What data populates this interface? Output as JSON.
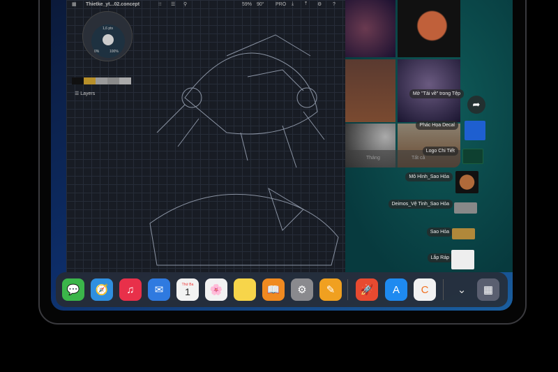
{
  "concept_app": {
    "file_name": "Thietke_yt...02.concept",
    "zoom": "59%",
    "angle": "90°",
    "pro_label": "PRO",
    "brush_size": "1,6 pts",
    "opacity_min": "0%",
    "opacity_max": "100%",
    "layers_label": "Layers",
    "swatch_colors": [
      "#101010",
      "#b8902a",
      "#9a9a9a",
      "#8a8a8a",
      "#aaaaaa"
    ]
  },
  "photos": {
    "tabs": [
      "Tháng",
      "Tất cả"
    ]
  },
  "drag_menu": {
    "items": [
      {
        "label": "Mở \"Tải về\" trong Tệp"
      },
      {
        "label": "Phác Họa Decal"
      },
      {
        "label": "Logo Chi Tiết"
      },
      {
        "label": "Mô Hình_Sao Hỏa"
      },
      {
        "label": "Deimos_Vệ Tinh_Sao Hỏa"
      },
      {
        "label": "Sao Hỏa"
      },
      {
        "label": "Lắp Ráp"
      }
    ]
  },
  "dock": {
    "calendar_day": "Thứ Ba",
    "calendar_date": "1",
    "apps": [
      "messages",
      "safari",
      "music",
      "mail",
      "calendar",
      "photos",
      "notes",
      "books",
      "settings",
      "pages",
      "rocket",
      "app-store",
      "concepts",
      "app-library"
    ]
  }
}
